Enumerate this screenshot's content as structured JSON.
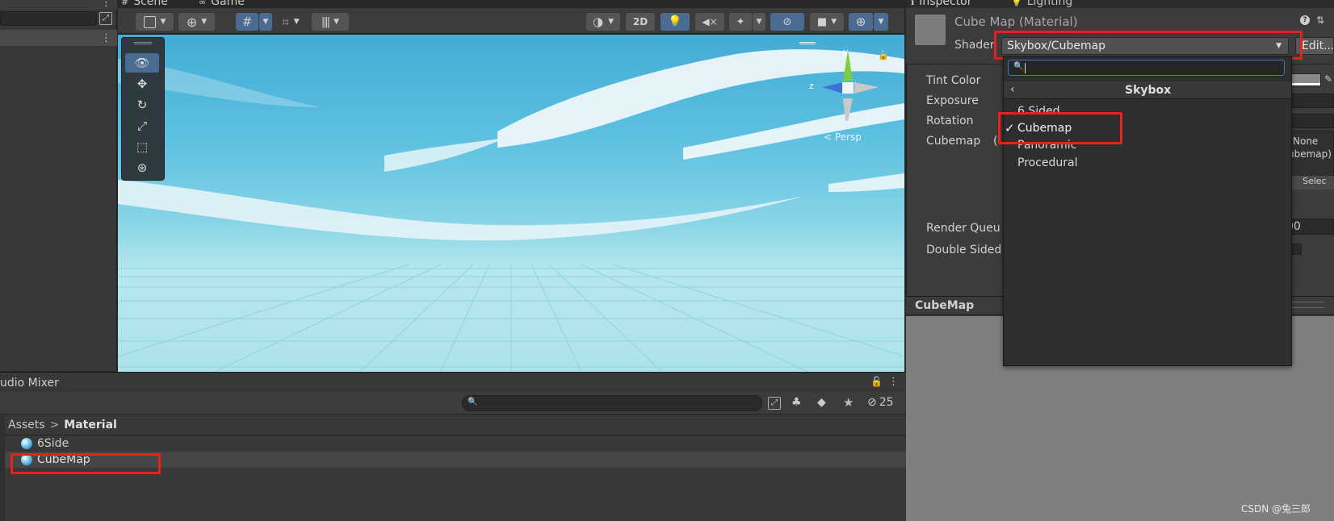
{
  "tabs": {
    "scene": "Scene",
    "game": "Game",
    "inspector": "Inspector",
    "lighting": "Lighting",
    "audio_mixer": "udio Mixer"
  },
  "scene_toolbar": {
    "mode_2d": "2D",
    "persp_label": "< Persp",
    "gizmo_y": "y",
    "gizmo_z": "z"
  },
  "inspector": {
    "material_title": "Cube Map (Material)",
    "shader_label": "Shader",
    "shader_value": "Skybox/Cubemap",
    "edit_button": "Edit...",
    "properties": [
      {
        "label": "Tint Color"
      },
      {
        "label": "Exposure"
      },
      {
        "label": "Rotation"
      },
      {
        "label": "Cubemap"
      },
      {
        "label": "Render Queu"
      },
      {
        "label": "Double Sided"
      }
    ],
    "cubemap_paren": "(",
    "cubemap_none": "None",
    "cubemap_type": "ubemap)",
    "select_button": "Selec",
    "render_queue_value": "00",
    "preview_title": "CubeMap"
  },
  "shader_dropdown": {
    "search_placeholder": "",
    "header": "Skybox",
    "items": [
      {
        "label": "6 Sided",
        "checked": false
      },
      {
        "label": "Cubemap",
        "checked": true
      },
      {
        "label": "Panoramic",
        "checked": false
      },
      {
        "label": "Procedural",
        "checked": false
      }
    ],
    "check_glyph": "✓"
  },
  "project": {
    "breadcrumb_root": "Assets",
    "breadcrumb_sep": ">",
    "breadcrumb_current": "Material",
    "hidden_count": "25",
    "assets": [
      {
        "name": "6Side",
        "selected": false
      },
      {
        "name": "CubeMap",
        "selected": true
      }
    ]
  },
  "watermark": "CSDN @兔三郎",
  "colors": {
    "highlight_red": "#e5221b",
    "panel_bg": "#383838",
    "dropdown_bg": "#2e2e2e",
    "active_blue": "#3a79bb",
    "sky_top": "#4fb8dc",
    "sky_horizon": "#b8e8ef"
  }
}
